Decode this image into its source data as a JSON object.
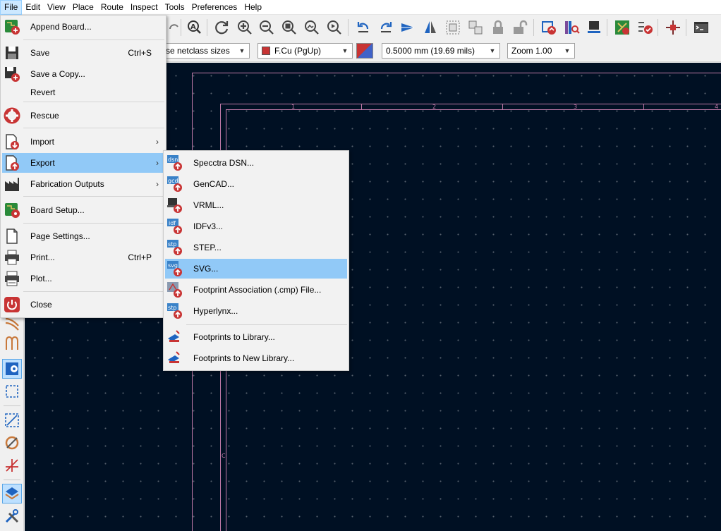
{
  "menubar": [
    "File",
    "Edit",
    "View",
    "Place",
    "Route",
    "Inspect",
    "Tools",
    "Preferences",
    "Help"
  ],
  "toolbar2": {
    "track_width": "se netclass sizes",
    "layer": "F.Cu (PgUp)",
    "via_size": "0.5000 mm (19.69 mils)",
    "zoom": "Zoom 1.00"
  },
  "file_menu": {
    "append": "Append Board...",
    "save": "Save",
    "save_sc": "Ctrl+S",
    "save_copy": "Save a Copy...",
    "revert": "Revert",
    "rescue": "Rescue",
    "import": "Import",
    "export": "Export",
    "fab": "Fabrication Outputs",
    "board_setup": "Board Setup...",
    "page_settings": "Page Settings...",
    "print": "Print...",
    "print_sc": "Ctrl+P",
    "plot": "Plot...",
    "close": "Close"
  },
  "export_menu": {
    "specctra": "Specctra DSN...",
    "gencad": "GenCAD...",
    "vrml": "VRML...",
    "idf": "IDFv3...",
    "step": "STEP...",
    "svg": "SVG...",
    "fp_assoc": "Footprint Association (.cmp) File...",
    "hyperlynx": "Hyperlynx...",
    "fp_lib": "Footprints to Library...",
    "fp_new_lib": "Footprints to New Library..."
  },
  "icon_tags": {
    "dsn": "dsn",
    "gcd": "gcd",
    "idf": "idf",
    "stp": "stp",
    "svg": "svg"
  },
  "ruler": {
    "c1": "1",
    "c2": "2",
    "c3": "3",
    "c4": "4",
    "side": "C"
  }
}
